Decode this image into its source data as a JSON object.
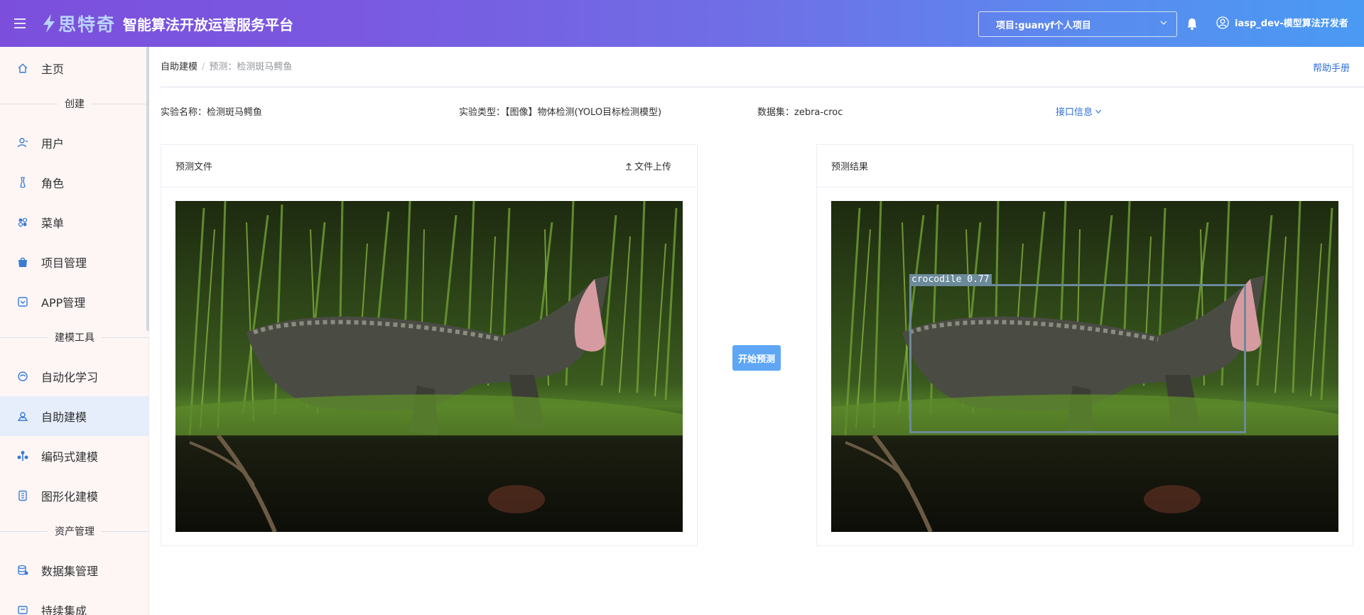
{
  "header": {
    "brand": "思特奇",
    "title": "智能算法开放运营服务平台",
    "project": "项目:guanyf个人项目",
    "user": "iasp_dev-模型算法开发者"
  },
  "sidebar": {
    "items": [
      {
        "label": "主页",
        "icon": "home-icon"
      },
      {
        "label": "用户",
        "icon": "user-icon"
      },
      {
        "label": "角色",
        "icon": "role-icon"
      },
      {
        "label": "菜单",
        "icon": "menu-grid-icon"
      },
      {
        "label": "项目管理",
        "icon": "bag-icon"
      },
      {
        "label": "APP管理",
        "icon": "app-icon"
      },
      {
        "label": "自动化学习",
        "icon": "auto-learn-icon"
      },
      {
        "label": "自助建模",
        "icon": "self-model-icon"
      },
      {
        "label": "编码式建模",
        "icon": "code-model-icon"
      },
      {
        "label": "图形化建模",
        "icon": "graph-model-icon"
      },
      {
        "label": "数据集管理",
        "icon": "dataset-icon"
      },
      {
        "label": "持续集成",
        "icon": "ci-icon"
      }
    ],
    "sections": [
      "创建",
      "建模工具",
      "资产管理"
    ],
    "active": "自助建模"
  },
  "breadcrumb": {
    "parent": "自助建模",
    "separator": "/",
    "current": "预测：检测斑马鳄鱼"
  },
  "help_link": "帮助手册",
  "experiment": {
    "name": "实验名称：检测斑马鳄鱼",
    "type": "实验类型：【图像】物体检测(YOLO目标检测模型)",
    "dataset": "数据集：zebra-croc",
    "interface_info": "接口信息"
  },
  "predict_file_panel": {
    "title": "预测文件",
    "upload_label": "文件上传"
  },
  "start_button": "开始预测",
  "result_panel": {
    "title": "预测结果",
    "detection_label": "crocodile  0.77"
  },
  "colors": {
    "accent": "#2f6fd6",
    "button": "#5fa6f5",
    "sidebar_bg": "#fdf6f5",
    "sidebar_active": "#e6eefb",
    "bbox": "#6b8a9a"
  }
}
